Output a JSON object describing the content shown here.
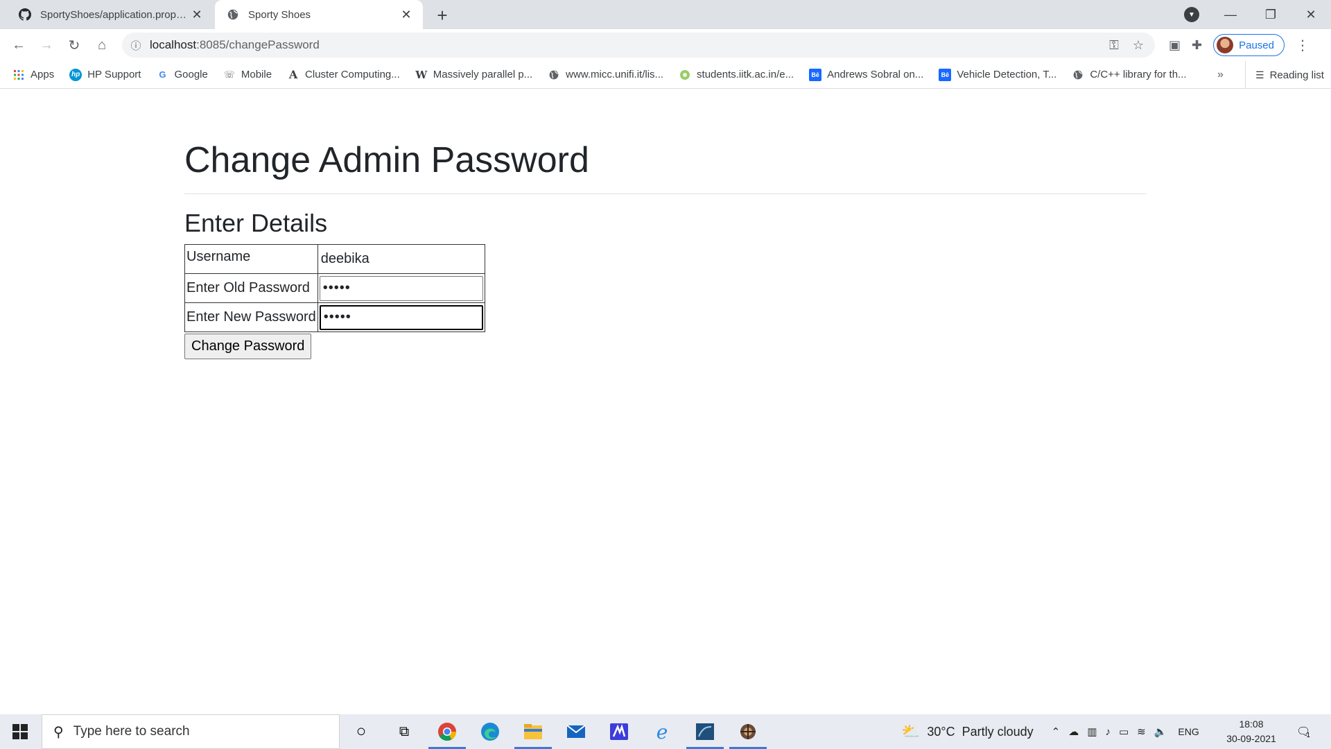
{
  "browser": {
    "tabs": [
      {
        "title": "SportyShoes/application.properti",
        "favicon": "github-icon",
        "active": false
      },
      {
        "title": "Sporty Shoes",
        "favicon": "globe-icon",
        "active": true
      }
    ],
    "new_tab_label": "+",
    "url_host": "localhost",
    "url_path": ":8085/changePassword",
    "profile_label": "Paused",
    "bookmarks": [
      {
        "label": "Apps",
        "icon": "apps-grid-icon"
      },
      {
        "label": "HP Support",
        "icon": "hp-icon"
      },
      {
        "label": "Google",
        "icon": "google-icon"
      },
      {
        "label": "Mobile",
        "icon": "mobile-icon"
      },
      {
        "label": "Cluster Computing...",
        "icon": "a-icon"
      },
      {
        "label": "Massively parallel p...",
        "icon": "wikipedia-icon"
      },
      {
        "label": "www.micc.unifi.it/lis...",
        "icon": "globe-icon"
      },
      {
        "label": "students.iitk.ac.in/e...",
        "icon": "iitk-icon"
      },
      {
        "label": "Andrews Sobral on...",
        "icon": "behance-icon"
      },
      {
        "label": "Vehicle Detection, T...",
        "icon": "behance-icon"
      },
      {
        "label": "C/C++ library for th...",
        "icon": "globe-icon"
      }
    ],
    "bookmarks_more": "»",
    "reading_list_label": "Reading list"
  },
  "page": {
    "title": "Change Admin Password",
    "subtitle": "Enter Details",
    "form": {
      "username_label": "Username",
      "username_value": "deebika",
      "old_password_label": "Enter Old Password",
      "old_password_value": "•••••",
      "new_password_label": "Enter New Password",
      "new_password_value": "•••••",
      "submit_label": "Change Password"
    }
  },
  "taskbar": {
    "search_placeholder": "Type here to search",
    "weather_temp": "30°C",
    "weather_desc": "Partly cloudy",
    "language": "ENG",
    "time": "18:08",
    "date": "30-09-2021",
    "notification_count": "1"
  }
}
